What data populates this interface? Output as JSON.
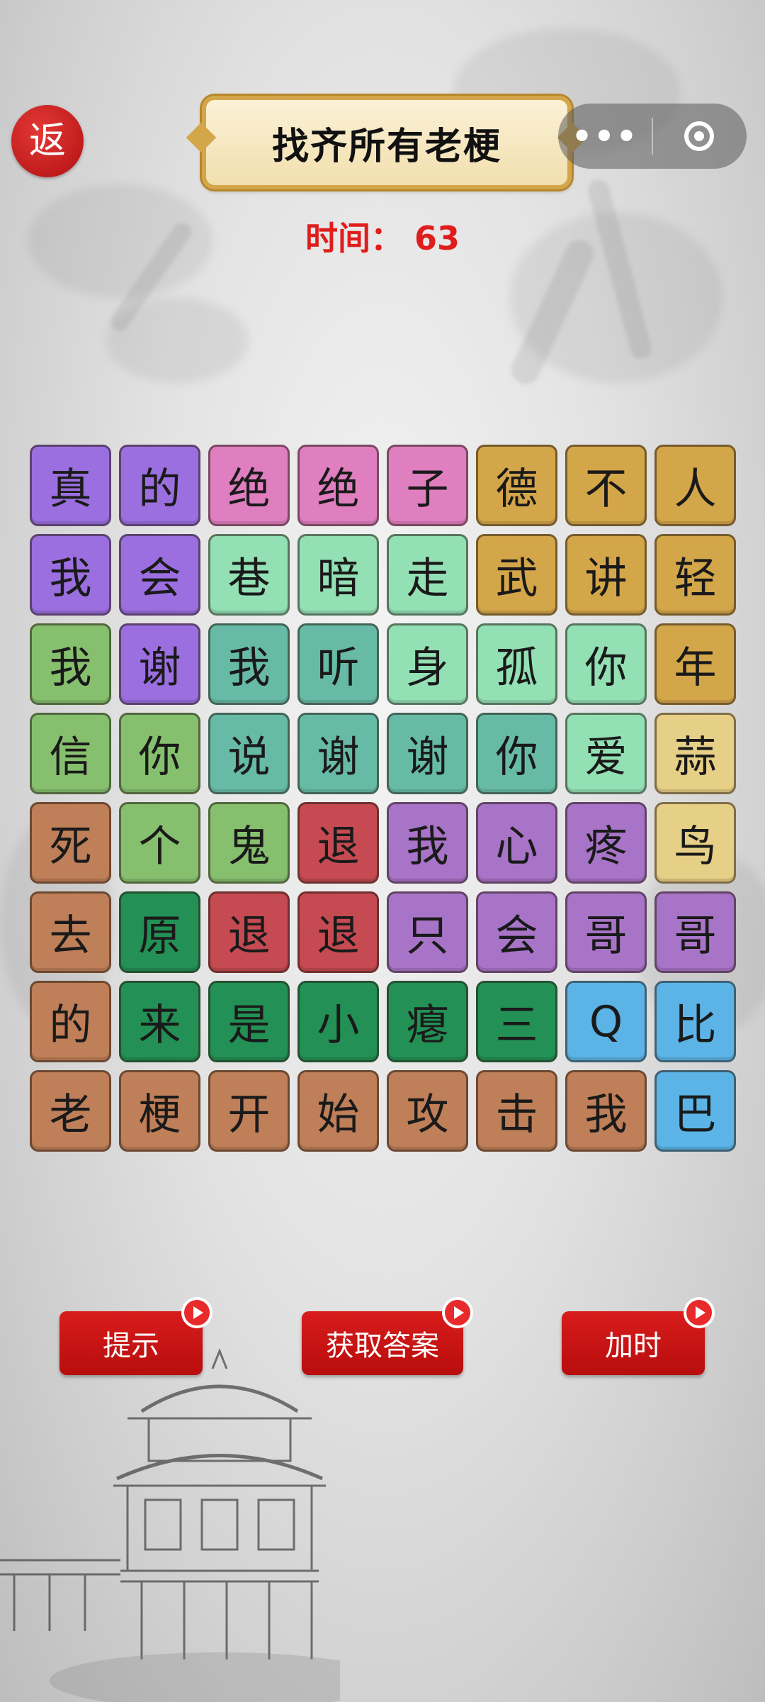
{
  "header": {
    "back_label": "返",
    "title": "找齐所有老梗",
    "more_icon": "more-dots-icon",
    "close_icon": "target-close-icon"
  },
  "timer": {
    "label": "时间：",
    "value": "63",
    "text": "时间：  63"
  },
  "colors": {
    "violet": "#9b6fe0",
    "pink": "#e07fc0",
    "gold": "#d4a64a",
    "mint": "#93e0b5",
    "teal": "#67bba6",
    "green": "#86c06f",
    "cream": "#e6cf86",
    "brown": "#bf7f58",
    "mauve": "#a874c7",
    "red": "#c64a52",
    "darkgreen": "#239055",
    "blue": "#5cb4e6"
  },
  "grid": {
    "rows": [
      [
        {
          "c": "真",
          "k": "violet"
        },
        {
          "c": "的",
          "k": "violet"
        },
        {
          "c": "绝",
          "k": "pink"
        },
        {
          "c": "绝",
          "k": "pink"
        },
        {
          "c": "子",
          "k": "pink"
        },
        {
          "c": "德",
          "k": "gold"
        },
        {
          "c": "不",
          "k": "gold"
        },
        {
          "c": "人",
          "k": "gold"
        }
      ],
      [
        {
          "c": "我",
          "k": "violet"
        },
        {
          "c": "会",
          "k": "violet"
        },
        {
          "c": "巷",
          "k": "mint"
        },
        {
          "c": "暗",
          "k": "mint"
        },
        {
          "c": "走",
          "k": "mint"
        },
        {
          "c": "武",
          "k": "gold"
        },
        {
          "c": "讲",
          "k": "gold"
        },
        {
          "c": "轻",
          "k": "gold"
        }
      ],
      [
        {
          "c": "我",
          "k": "green"
        },
        {
          "c": "谢",
          "k": "violet"
        },
        {
          "c": "我",
          "k": "teal"
        },
        {
          "c": "听",
          "k": "teal"
        },
        {
          "c": "身",
          "k": "mint"
        },
        {
          "c": "孤",
          "k": "mint"
        },
        {
          "c": "你",
          "k": "mint"
        },
        {
          "c": "年",
          "k": "gold"
        }
      ],
      [
        {
          "c": "信",
          "k": "green"
        },
        {
          "c": "你",
          "k": "green"
        },
        {
          "c": "说",
          "k": "teal"
        },
        {
          "c": "谢",
          "k": "teal"
        },
        {
          "c": "谢",
          "k": "teal"
        },
        {
          "c": "你",
          "k": "teal"
        },
        {
          "c": "爱",
          "k": "mint"
        },
        {
          "c": "蒜",
          "k": "cream"
        }
      ],
      [
        {
          "c": "死",
          "k": "brown"
        },
        {
          "c": "个",
          "k": "green"
        },
        {
          "c": "鬼",
          "k": "green"
        },
        {
          "c": "退",
          "k": "red"
        },
        {
          "c": "我",
          "k": "mauve"
        },
        {
          "c": "心",
          "k": "mauve"
        },
        {
          "c": "疼",
          "k": "mauve"
        },
        {
          "c": "鸟",
          "k": "cream"
        }
      ],
      [
        {
          "c": "去",
          "k": "brown"
        },
        {
          "c": "原",
          "k": "darkgreen"
        },
        {
          "c": "退",
          "k": "red"
        },
        {
          "c": "退",
          "k": "red"
        },
        {
          "c": "只",
          "k": "mauve"
        },
        {
          "c": "会",
          "k": "mauve"
        },
        {
          "c": "哥",
          "k": "mauve"
        },
        {
          "c": "哥",
          "k": "mauve"
        }
      ],
      [
        {
          "c": "的",
          "k": "brown"
        },
        {
          "c": "来",
          "k": "darkgreen"
        },
        {
          "c": "是",
          "k": "darkgreen"
        },
        {
          "c": "小",
          "k": "darkgreen"
        },
        {
          "c": "瘪",
          "k": "darkgreen"
        },
        {
          "c": "三",
          "k": "darkgreen"
        },
        {
          "c": "Q",
          "k": "blue"
        },
        {
          "c": "比",
          "k": "blue"
        }
      ],
      [
        {
          "c": "老",
          "k": "brown"
        },
        {
          "c": "梗",
          "k": "brown"
        },
        {
          "c": "开",
          "k": "brown"
        },
        {
          "c": "始",
          "k": "brown"
        },
        {
          "c": "攻",
          "k": "brown"
        },
        {
          "c": "击",
          "k": "brown"
        },
        {
          "c": "我",
          "k": "brown"
        },
        {
          "c": "巴",
          "k": "blue"
        }
      ]
    ]
  },
  "buttons": {
    "hint": "提示",
    "answer": "获取答案",
    "add_time": "加时",
    "badge_icon": "play-icon"
  }
}
